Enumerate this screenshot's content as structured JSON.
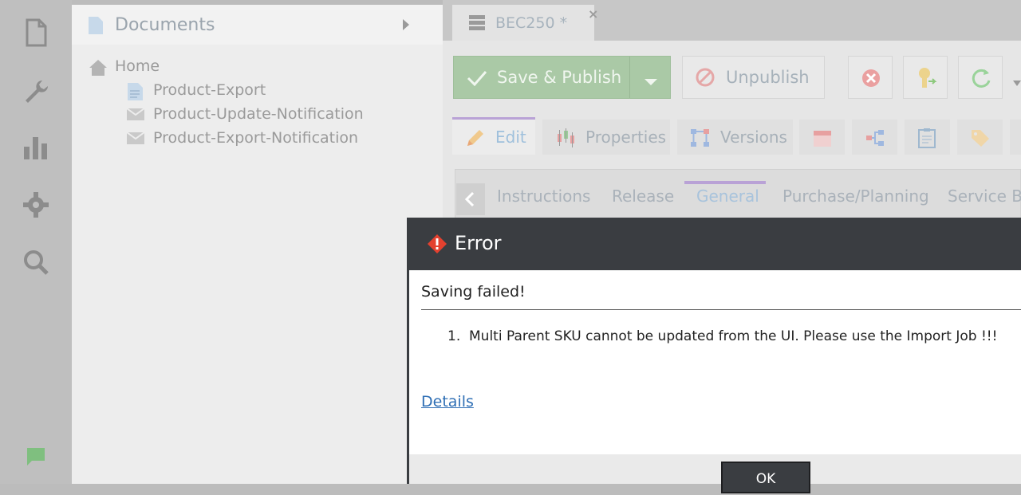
{
  "rail": {
    "icons": [
      "document-icon",
      "wrench-icon",
      "bar-chart-icon",
      "gear-icon",
      "search-icon",
      "chat-icon"
    ]
  },
  "tree": {
    "title": "Documents",
    "nodes": [
      {
        "label": "Home",
        "icon": "home-icon"
      },
      {
        "label": "Product-Export",
        "icon": "page-icon"
      },
      {
        "label": "Product-Update-Notification",
        "icon": "email-icon"
      },
      {
        "label": "Product-Export-Notification",
        "icon": "email-icon"
      }
    ]
  },
  "doc_tab": {
    "label": "BEC250 *",
    "close": "×"
  },
  "toolbar": {
    "save_label": "Save & Publish",
    "unpublish_label": "Unpublish"
  },
  "subtabs": [
    {
      "label": "Edit"
    },
    {
      "label": "Properties"
    },
    {
      "label": "Versions"
    }
  ],
  "inner_tabs": [
    {
      "label": "Instructions"
    },
    {
      "label": "Release"
    },
    {
      "label": "General"
    },
    {
      "label": "Purchase/Planning"
    },
    {
      "label": "Service BC"
    }
  ],
  "dialog": {
    "title": "Error",
    "message": "Saving failed!",
    "items": [
      {
        "num": "1.",
        "text": "Multi Parent SKU cannot be updated from the UI. Please use the Import Job !!!"
      }
    ],
    "details_label": "Details",
    "ok_label": "OK"
  },
  "colors": {
    "accent_purple": "#b9a2d6",
    "save_green": "#aac9a6",
    "error_red": "#e3412f",
    "dialog_dark": "#3a3d41",
    "link_blue": "#2f6fb5"
  }
}
